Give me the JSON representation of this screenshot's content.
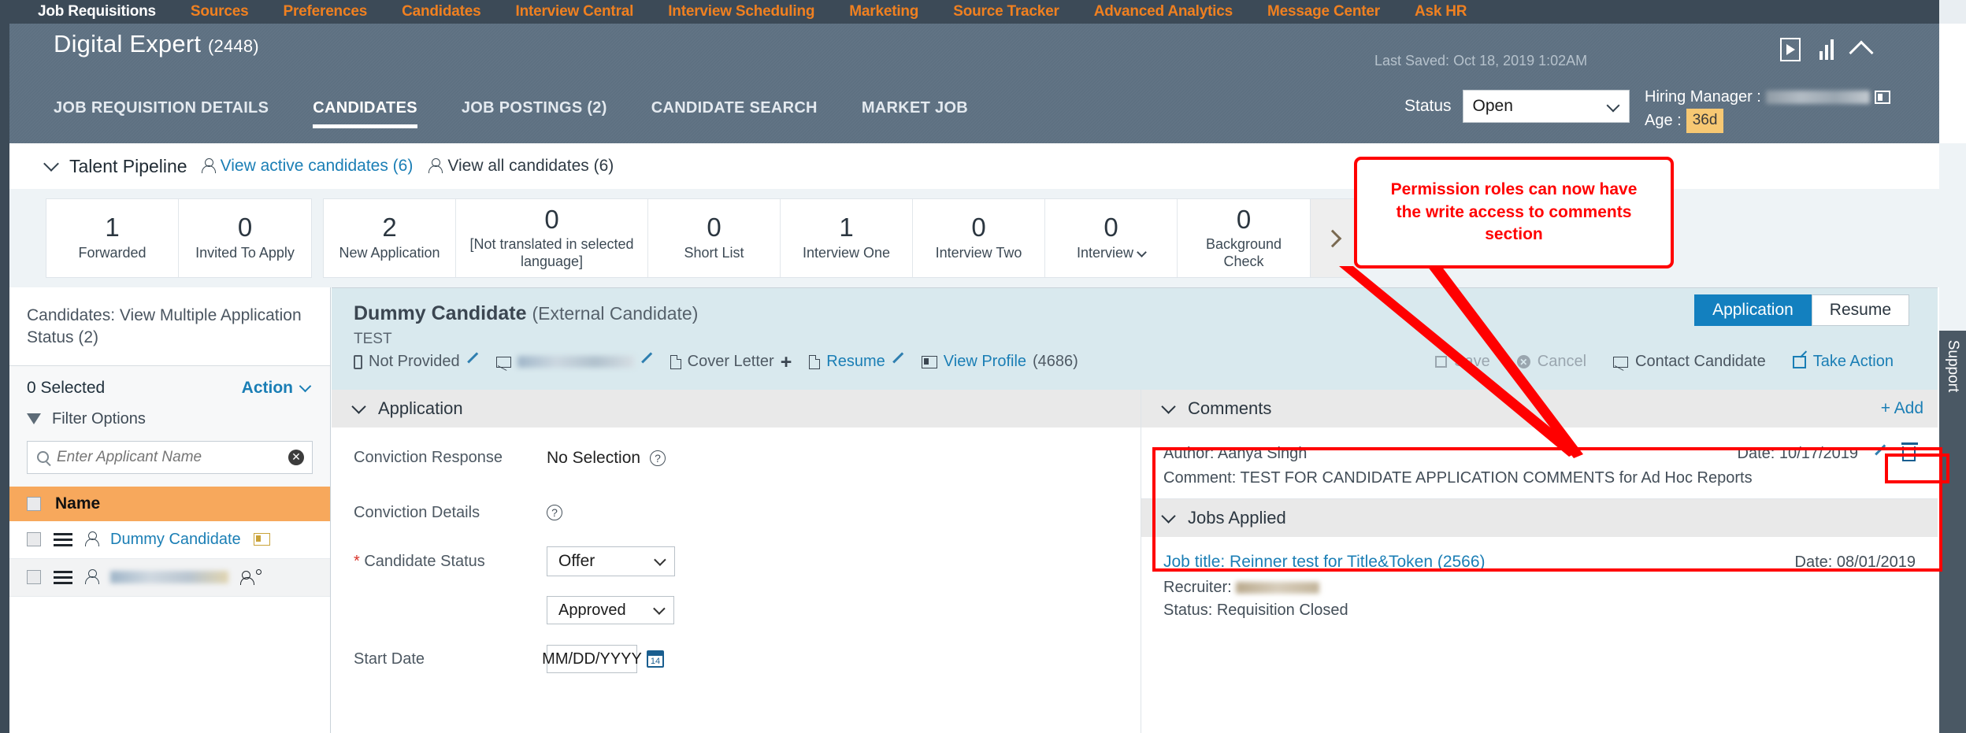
{
  "topnav": {
    "items": [
      {
        "label": "Job Requisitions",
        "active": true
      },
      {
        "label": "Sources",
        "active": false
      },
      {
        "label": "Preferences",
        "active": false
      },
      {
        "label": "Candidates",
        "active": false
      },
      {
        "label": "Interview Central",
        "active": false
      },
      {
        "label": "Interview Scheduling",
        "active": false
      },
      {
        "label": "Marketing",
        "active": false
      },
      {
        "label": "Source Tracker",
        "active": false
      },
      {
        "label": "Advanced Analytics",
        "active": false
      },
      {
        "label": "Message Center",
        "active": false
      },
      {
        "label": "Ask HR",
        "active": false
      }
    ]
  },
  "header": {
    "title": "Digital Expert",
    "req_id": "(2448)",
    "last_saved": "Last Saved: Oct 18, 2019 1:02AM",
    "status_label": "Status",
    "status_value": "Open",
    "hiring_manager_label": "Hiring Manager :",
    "age_label": "Age :",
    "age_value": "36d",
    "tabs": [
      {
        "label": "JOB REQUISITION DETAILS",
        "active": false
      },
      {
        "label": "CANDIDATES",
        "active": true
      },
      {
        "label": "JOB POSTINGS (2)",
        "active": false
      },
      {
        "label": "CANDIDATE SEARCH",
        "active": false
      },
      {
        "label": "MARKET JOB",
        "active": false
      }
    ]
  },
  "pipeline": {
    "title": "Talent Pipeline",
    "view_active": "View active candidates (6)",
    "view_all": "View all candidates (6)",
    "group1": [
      {
        "count": "1",
        "label": "Forwarded"
      },
      {
        "count": "0",
        "label": "Invited To Apply"
      }
    ],
    "group2": [
      {
        "count": "2",
        "label": "New Application"
      },
      {
        "count": "0",
        "label": "[Not translated in selected language]",
        "wide": true
      },
      {
        "count": "0",
        "label": "Short List"
      },
      {
        "count": "1",
        "label": "Interview One"
      },
      {
        "count": "0",
        "label": "Interview Two"
      },
      {
        "count": "0",
        "label": "Interview",
        "caret": true
      },
      {
        "count": "0",
        "label": "Background Check"
      }
    ]
  },
  "left_panel": {
    "heading": "Candidates: View Multiple Application Status (2)",
    "selected_count": "0 Selected",
    "action_label": "Action",
    "filter_label": "Filter Options",
    "search_placeholder": "Enter Applicant Name",
    "column_header": "Name",
    "rows": [
      {
        "name": "Dummy Candidate",
        "redacted": false
      },
      {
        "name": "",
        "redacted": true
      }
    ]
  },
  "candidate": {
    "name": "Dummy Candidate",
    "type": "(External Candidate)",
    "tag": "TEST",
    "phone": "Not Provided",
    "cover_letter": "Cover Letter",
    "resume": "Resume",
    "view_profile": "View Profile",
    "profile_id": "(4686)",
    "actions": {
      "save": "Save",
      "cancel": "Cancel",
      "contact": "Contact Candidate",
      "take_action": "Take Action"
    },
    "view_tabs": [
      {
        "label": "Application",
        "selected": true
      },
      {
        "label": "Resume",
        "selected": false
      }
    ]
  },
  "application": {
    "section_title": "Application",
    "fields": [
      {
        "label": "Conviction Response",
        "value": "No Selection",
        "help": true
      },
      {
        "label": "Conviction Details",
        "value": "",
        "help": true
      },
      {
        "label": "Candidate Status",
        "required": true,
        "value": "Offer"
      },
      {
        "label": "",
        "value": "Approved"
      },
      {
        "label": "Start Date",
        "value": "MM/DD/YYYY"
      }
    ]
  },
  "comments": {
    "section_title": "Comments",
    "add_label": "+ Add",
    "entries": [
      {
        "author": "Author: Aanya Singh",
        "date": "Date: 10/17/2019",
        "comment": "Comment: TEST FOR CANDIDATE APPLICATION COMMENTS for Ad Hoc Reports"
      }
    ]
  },
  "jobs_applied": {
    "section_title": "Jobs Applied",
    "entries": [
      {
        "title": "Job title: Reinner test for Title&Token (2566)",
        "date": "Date: 08/01/2019",
        "recruiter_label": "Recruiter:",
        "status_label": "Status:",
        "status_value": "Requisition Closed"
      }
    ]
  },
  "annotation": {
    "text": "Permission roles can now have the write access to comments section",
    "color": "#ff0000"
  },
  "rail": {
    "support_label": "Support"
  },
  "colors": {
    "nav_bg": "#3c4a57",
    "nav_accent": "#f08020",
    "header_bg": "#5d7081",
    "link": "#1a7eb5",
    "table_header": "#f7a85c",
    "tab_selected": "#1380bf",
    "age_badge": "#f7c873"
  }
}
